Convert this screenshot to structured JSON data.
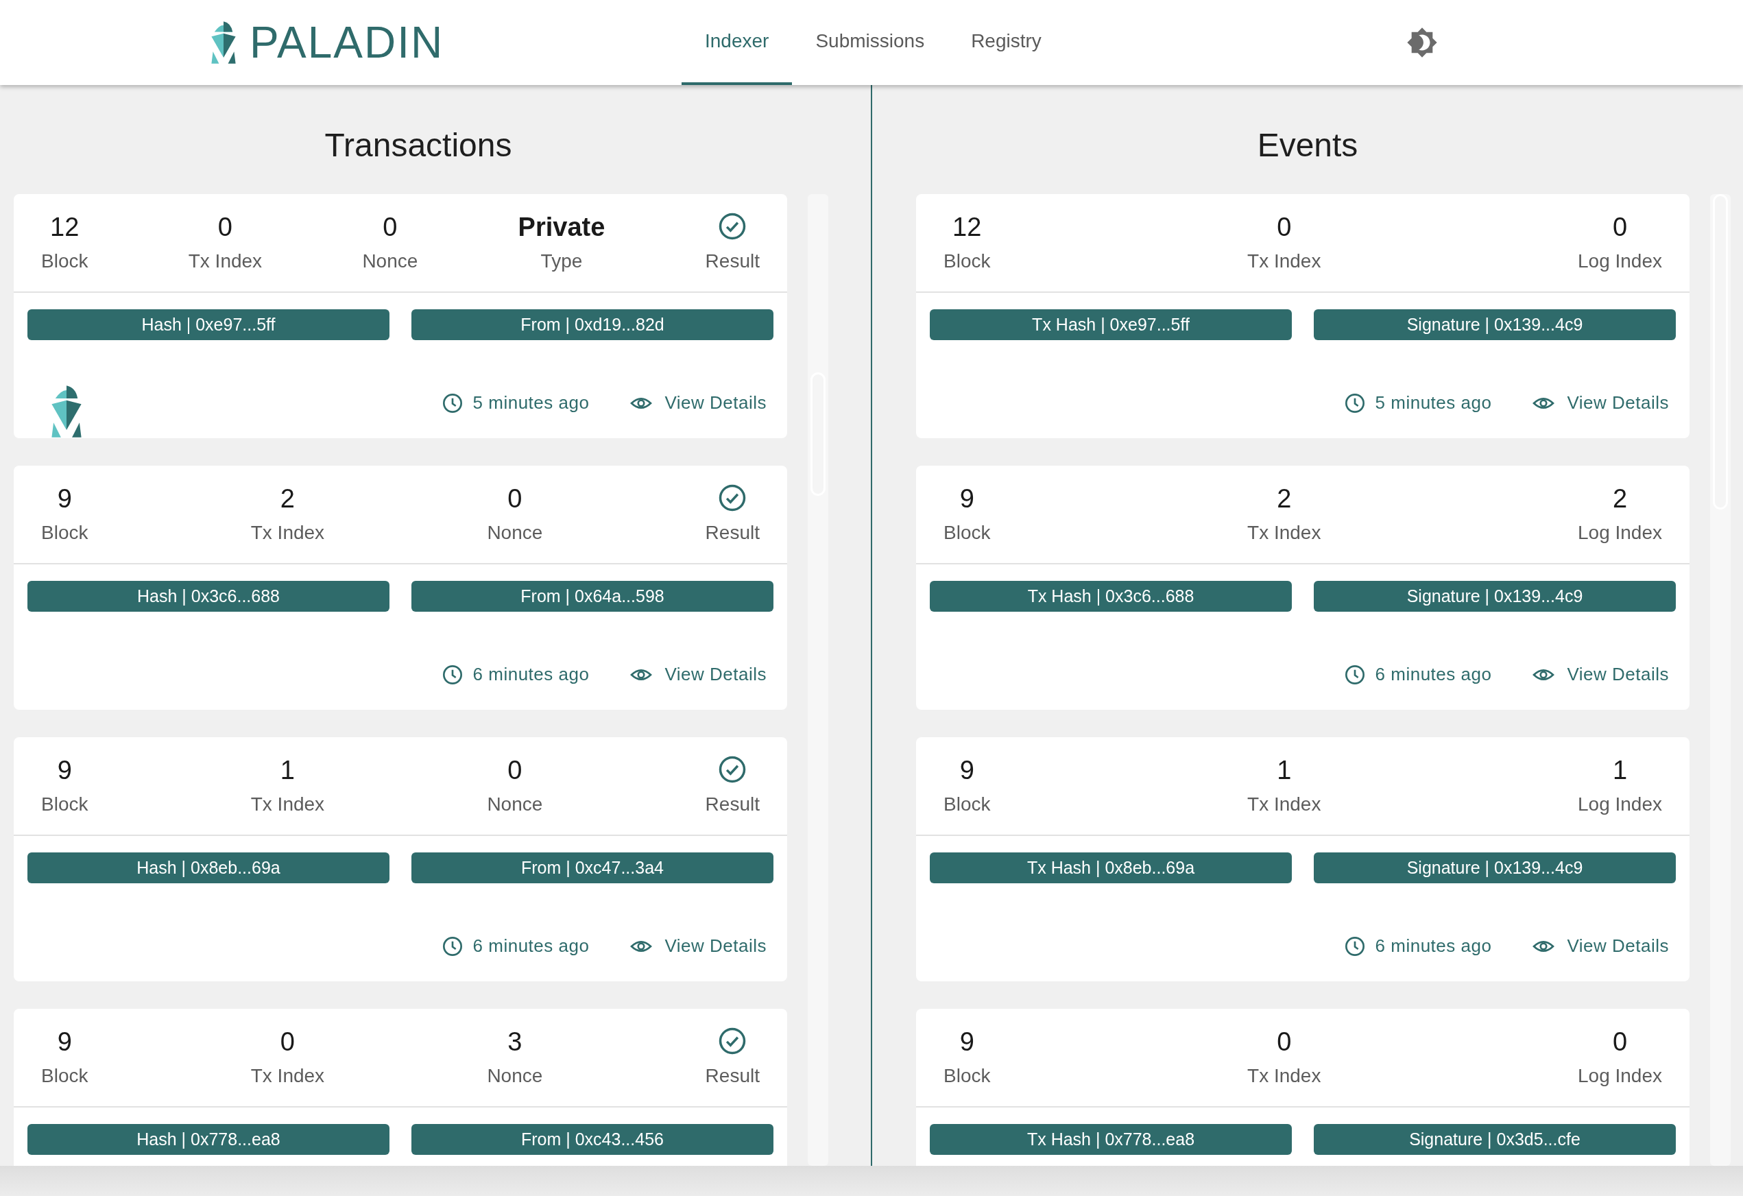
{
  "header": {
    "brand": "PALADIN",
    "tabs": [
      {
        "label": "Indexer",
        "selected": true
      },
      {
        "label": "Submissions",
        "selected": false
      },
      {
        "label": "Registry",
        "selected": false
      }
    ]
  },
  "transactions": {
    "title": "Transactions",
    "cards": [
      {
        "fields": [
          {
            "kind": "value",
            "value": "12",
            "label": "Block"
          },
          {
            "kind": "value",
            "value": "0",
            "label": "Tx Index"
          },
          {
            "kind": "value",
            "value": "0",
            "label": "Nonce"
          },
          {
            "kind": "type",
            "value": "Private",
            "label": "Type"
          },
          {
            "kind": "result",
            "label": "Result"
          }
        ],
        "chips": [
          "Hash | 0xe97...5ff",
          "From | 0xd19...82d"
        ],
        "paladin_mark": true,
        "time": "5 minutes ago",
        "link": "View Details"
      },
      {
        "fields": [
          {
            "kind": "value",
            "value": "9",
            "label": "Block"
          },
          {
            "kind": "value",
            "value": "2",
            "label": "Tx Index"
          },
          {
            "kind": "value",
            "value": "0",
            "label": "Nonce"
          },
          {
            "kind": "result",
            "label": "Result"
          }
        ],
        "chips": [
          "Hash | 0x3c6...688",
          "From | 0x64a...598"
        ],
        "paladin_mark": false,
        "time": "6 minutes ago",
        "link": "View Details"
      },
      {
        "fields": [
          {
            "kind": "value",
            "value": "9",
            "label": "Block"
          },
          {
            "kind": "value",
            "value": "1",
            "label": "Tx Index"
          },
          {
            "kind": "value",
            "value": "0",
            "label": "Nonce"
          },
          {
            "kind": "result",
            "label": "Result"
          }
        ],
        "chips": [
          "Hash | 0x8eb...69a",
          "From | 0xc47...3a4"
        ],
        "paladin_mark": false,
        "time": "6 minutes ago",
        "link": "View Details"
      },
      {
        "fields": [
          {
            "kind": "value",
            "value": "9",
            "label": "Block"
          },
          {
            "kind": "value",
            "value": "0",
            "label": "Tx Index"
          },
          {
            "kind": "value",
            "value": "3",
            "label": "Nonce"
          },
          {
            "kind": "result",
            "label": "Result"
          }
        ],
        "chips": [
          "Hash | 0x778...ea8",
          "From | 0xc43...456"
        ],
        "paladin_mark": false
      }
    ]
  },
  "events": {
    "title": "Events",
    "cards": [
      {
        "fields": [
          {
            "kind": "value",
            "value": "12",
            "label": "Block"
          },
          {
            "kind": "value",
            "value": "0",
            "label": "Tx Index"
          },
          {
            "kind": "value",
            "value": "0",
            "label": "Log Index"
          }
        ],
        "chips": [
          "Tx Hash | 0xe97...5ff",
          "Signature | 0x139...4c9"
        ],
        "time": "5 minutes ago",
        "link": "View Details"
      },
      {
        "fields": [
          {
            "kind": "value",
            "value": "9",
            "label": "Block"
          },
          {
            "kind": "value",
            "value": "2",
            "label": "Tx Index"
          },
          {
            "kind": "value",
            "value": "2",
            "label": "Log Index"
          }
        ],
        "chips": [
          "Tx Hash | 0x3c6...688",
          "Signature | 0x139...4c9"
        ],
        "time": "6 minutes ago",
        "link": "View Details"
      },
      {
        "fields": [
          {
            "kind": "value",
            "value": "9",
            "label": "Block"
          },
          {
            "kind": "value",
            "value": "1",
            "label": "Tx Index"
          },
          {
            "kind": "value",
            "value": "1",
            "label": "Log Index"
          }
        ],
        "chips": [
          "Tx Hash | 0x8eb...69a",
          "Signature | 0x139...4c9"
        ],
        "time": "6 minutes ago",
        "link": "View Details"
      },
      {
        "fields": [
          {
            "kind": "value",
            "value": "9",
            "label": "Block"
          },
          {
            "kind": "value",
            "value": "0",
            "label": "Tx Index"
          },
          {
            "kind": "value",
            "value": "0",
            "label": "Log Index"
          }
        ],
        "chips": [
          "Tx Hash | 0x778...ea8",
          "Signature | 0x3d5...cfe"
        ]
      }
    ]
  }
}
